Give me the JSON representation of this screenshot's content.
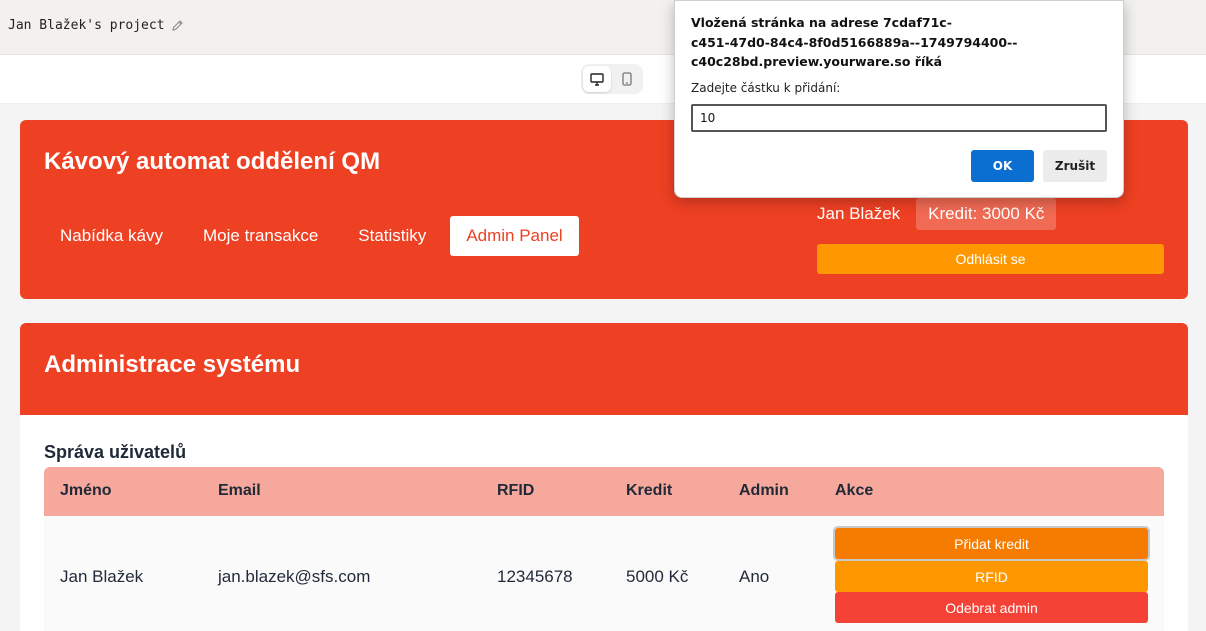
{
  "editor": {
    "project_title": "Jan Blažek's project",
    "edit_icon": "pencil-icon",
    "device_toggle": {
      "desktop_icon": "monitor-icon",
      "mobile_icon": "smartphone-icon",
      "selected": "desktop"
    }
  },
  "app": {
    "title": "Kávový automat oddělení QM",
    "nav": [
      {
        "label": "Nabídka kávy",
        "active": false
      },
      {
        "label": "Moje transakce",
        "active": false
      },
      {
        "label": "Statistiky",
        "active": false
      },
      {
        "label": "Admin Panel",
        "active": true
      }
    ],
    "user": {
      "name": "Jan Blažek",
      "credit": "Kredit: 3000 Kč",
      "logout_label": "Odhlásit se"
    },
    "colors": {
      "primary": "#ee4023",
      "table_header": "#f5a89b",
      "logout": "#ff9800",
      "add_credit": "#f57c00",
      "rfid": "#ff9800",
      "remove_admin": "#f44336"
    }
  },
  "admin": {
    "title": "Administrace systému",
    "section_title": "Správa uživatelů",
    "table": {
      "columns": [
        "Jméno",
        "Email",
        "RFID",
        "Kredit",
        "Admin",
        "Akce"
      ],
      "rows": [
        {
          "name": "Jan Blažek",
          "email": "jan.blazek@sfs.com",
          "rfid": "12345678",
          "credit": "5000 Kč",
          "admin": "Ano",
          "actions": {
            "add_credit": "Přidat kredit",
            "rfid": "RFID",
            "remove_admin": "Odebrat admin"
          }
        }
      ]
    }
  },
  "dialog": {
    "title": "Vložená stránka na adrese 7cdaf71c-c451-47d0-84c4-8f0d5166889a--1749794400--c40c28bd.preview.yourware.so říká",
    "title_lines": [
      "Vložená stránka na adrese 7cdaf71c-",
      "c451-47d0-84c4-8f0d5166889a--1749794400--",
      "c40c28bd.preview.yourware.so říká"
    ],
    "prompt": "Zadejte částku k přidání:",
    "input_value": "10",
    "ok_label": "OK",
    "cancel_label": "Zrušit"
  }
}
